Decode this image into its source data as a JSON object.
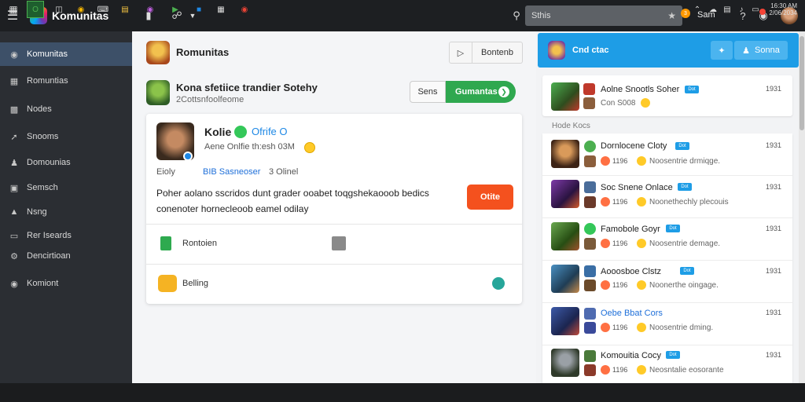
{
  "topbar": {
    "brand": "Komunitas",
    "search_value": "Sthis",
    "notif_count": "3",
    "user_short": "Sam"
  },
  "sidebar": {
    "items": [
      {
        "label": "Komunitas",
        "icon": "globe-icon"
      },
      {
        "label": "Romuntias",
        "icon": "grid-icon"
      },
      {
        "label": "Nodes",
        "icon": "node-icon"
      },
      {
        "label": "Snooms",
        "icon": "pin-icon"
      },
      {
        "label": "Domounias",
        "icon": "people-icon"
      },
      {
        "label": "Semsch",
        "icon": "monitor-icon"
      },
      {
        "label": "Nsng",
        "icon": "image-icon"
      },
      {
        "label": "Rer Iseards",
        "icon": "badge-icon"
      },
      {
        "label": "Dencirtioan",
        "icon": "settings-icon"
      },
      {
        "label": "Komiont",
        "icon": "globe-icon"
      }
    ]
  },
  "main": {
    "header_title": "Romunitas",
    "header_btn": "Bontenb",
    "subheader_title": "Kona sfetiice trandier Sotehy",
    "subheader_meta": "2Cottsnfoolfeome",
    "btn_gray": "Sens",
    "btn_green": "Gumantas",
    "card": {
      "name": "Kolie",
      "status": "Ofrife O",
      "status_line": "Aene Onlfie th:esh 03M",
      "line3_a": "Eioly",
      "line3_b": "BIB Sasneoser",
      "line3_c": "3 Olinel",
      "body": "Poher aolano sscridos dunt grader ooabet toqgshekaooob bedics conenoter hornecleoob eamel odilay",
      "cta": "Otite",
      "row1_label": "Rontoien",
      "row2_label": "Belling"
    }
  },
  "right_panel": {
    "header_title": "Cnd ctac",
    "header_btn": "Sonna",
    "pinned": {
      "title": "Aolne Snootls Soher",
      "sub": "Con S008",
      "tag": "Dot",
      "time": "1931"
    },
    "section_label": "Hode Kocs",
    "rows": [
      {
        "title": "Dornlocene Cloty",
        "num": "1196",
        "sub": "Noosentrie drmiqge.",
        "tag": "Dot",
        "time": "1931"
      },
      {
        "title": "Soc Snene Onlace",
        "num": "1196",
        "sub": "Noonethechly plecouis",
        "tag": "Dot",
        "time": "1931"
      },
      {
        "title": "Famobole Goyr",
        "num": "1196",
        "sub": "Noosentrie demage.",
        "tag": "Dot",
        "time": "1931"
      },
      {
        "title": "Aooosboe Clstz",
        "num": "1196",
        "sub": "Noonerthe oingage.",
        "tag": "Dot",
        "time": "1931"
      },
      {
        "title": "Oebe Bbat Cors",
        "num": "1196",
        "sub": "Noosentrie dming.",
        "tag": "",
        "time": "1931"
      },
      {
        "title": "Komouitia Cocy",
        "num": "1196",
        "sub": "Neosntalie eosorante",
        "tag": "Dot",
        "time": "1931"
      }
    ]
  },
  "taskbar": {
    "time": "16:30 AM",
    "date": "2/06/2034"
  },
  "colors": {
    "accent": "#1e9de6",
    "green": "#2fa84f",
    "orange": "#f4511e",
    "sidebar": "#2b2e33"
  }
}
